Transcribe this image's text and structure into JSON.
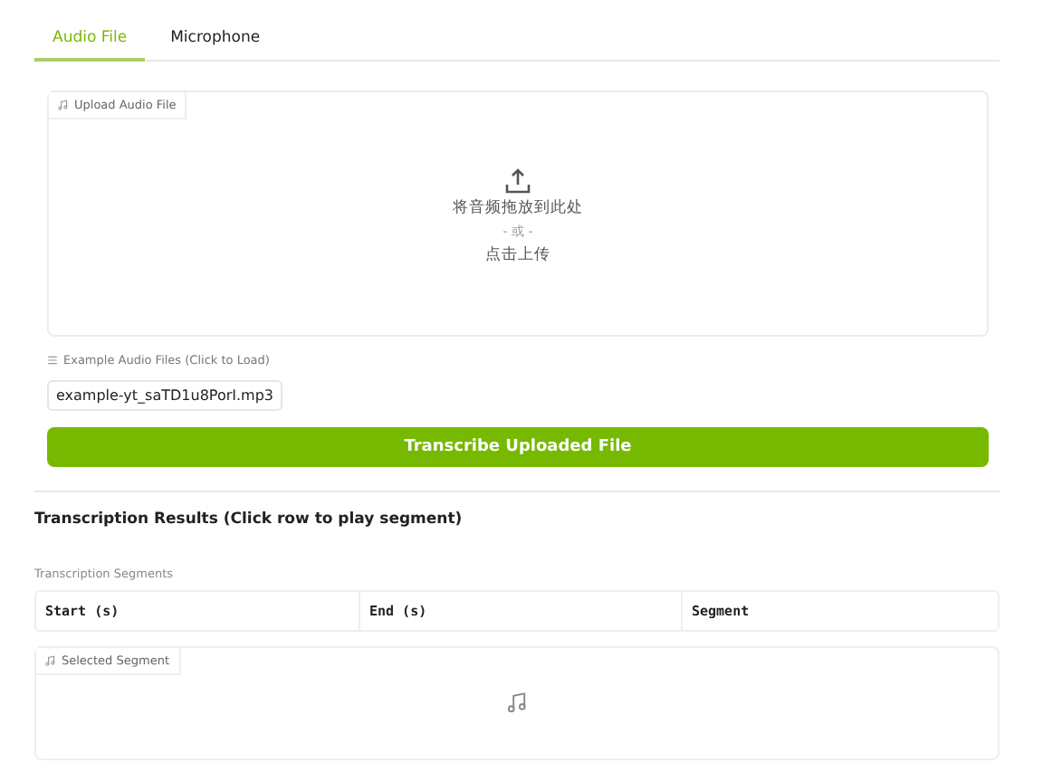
{
  "tabs": [
    {
      "label": "Audio File",
      "selected": true
    },
    {
      "label": "Microphone",
      "selected": false
    }
  ],
  "upload": {
    "label": "Upload Audio File",
    "drop_text": "将音频拖放到此处",
    "or_text": "- 或 -",
    "click_text": "点击上传"
  },
  "examples": {
    "label": "Example Audio Files (Click to Load)",
    "files": [
      "example-yt_saTD1u8PorI.mp3"
    ]
  },
  "transcribe_button": "Transcribe Uploaded File",
  "results_heading": "Transcription Results (Click row to play segment)",
  "table": {
    "label": "Transcription Segments",
    "columns": [
      "Start (s)",
      "End (s)",
      "Segment"
    ]
  },
  "player": {
    "label": "Selected Segment"
  }
}
